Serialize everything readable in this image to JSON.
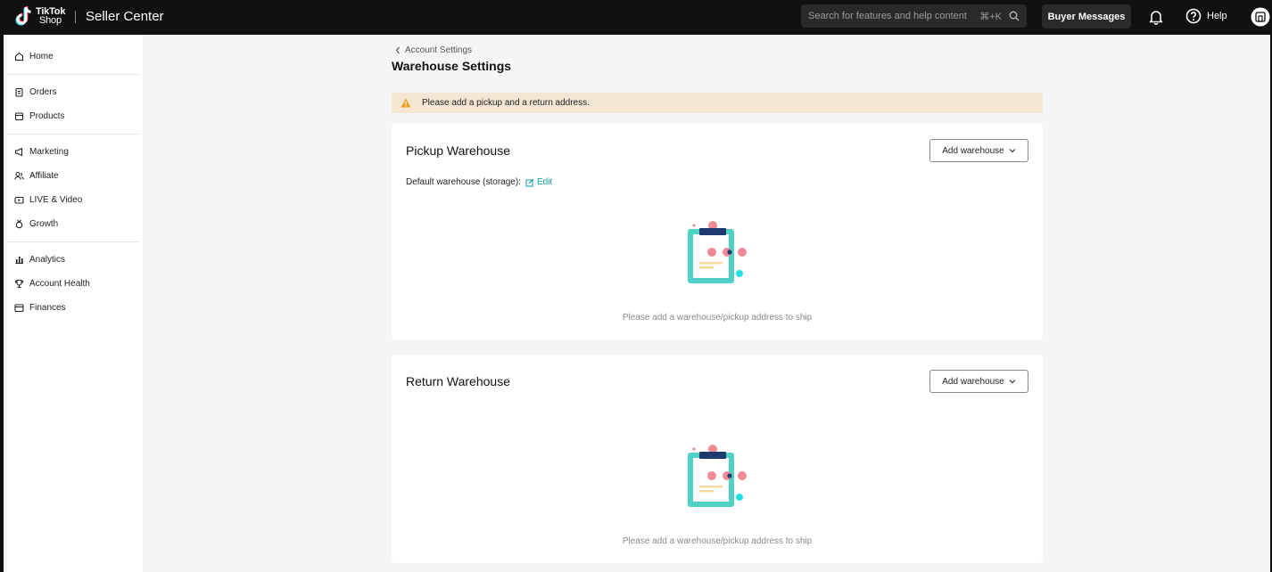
{
  "topbar": {
    "logo_line1": "TikTok",
    "logo_line2": "Shop",
    "app_title": "Seller Center",
    "search_placeholder": "Search for features and help content",
    "search_shortcut": "⌘+K",
    "buyer_messages": "Buyer Messages",
    "help": "Help"
  },
  "sidebar": {
    "groups": [
      [
        {
          "label": "Home",
          "icon": "home-icon"
        }
      ],
      [
        {
          "label": "Orders",
          "icon": "clipboard-icon"
        },
        {
          "label": "Products",
          "icon": "box-icon"
        }
      ],
      [
        {
          "label": "Marketing",
          "icon": "megaphone-icon"
        },
        {
          "label": "Affiliate",
          "icon": "users-icon"
        },
        {
          "label": "LIVE & Video",
          "icon": "video-icon"
        },
        {
          "label": "Growth",
          "icon": "rocket-icon"
        }
      ],
      [
        {
          "label": "Analytics",
          "icon": "chart-icon"
        },
        {
          "label": "Account Health",
          "icon": "trophy-icon"
        },
        {
          "label": "Finances",
          "icon": "wallet-icon"
        }
      ]
    ]
  },
  "main": {
    "breadcrumb": "Account Settings",
    "title": "Warehouse Settings",
    "alert": "Please add a pickup and a return address.",
    "pickup": {
      "title": "Pickup Warehouse",
      "add_label": "Add warehouse",
      "default_label": "Default warehouse (storage):",
      "edit_label": "Edit",
      "empty_text": "Please add a warehouse/pickup address to ship"
    },
    "return": {
      "title": "Return Warehouse",
      "add_label": "Add warehouse",
      "empty_text": "Please add a warehouse/pickup address to ship"
    }
  },
  "colors": {
    "topbar_bg": "#111111",
    "alert_bg": "#f4e6d3",
    "warning_icon": "#f0a020",
    "link": "#119ca6",
    "illus_teal": "#4fd1c5",
    "illus_pink": "#f08a96"
  }
}
